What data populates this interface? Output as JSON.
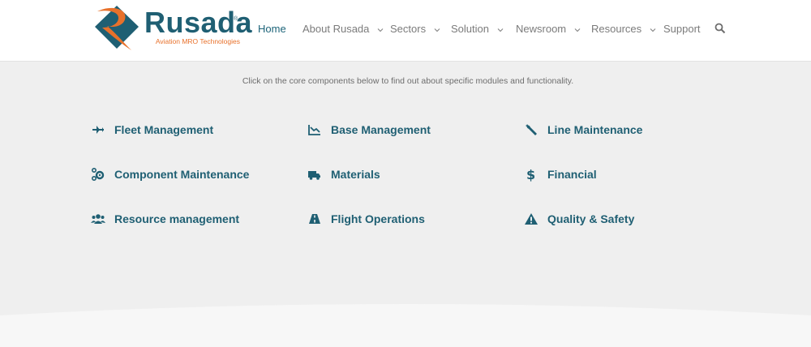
{
  "brand": {
    "name": "Rusada",
    "registered": "®",
    "tagline": "Aviation MRO Technologies"
  },
  "colors": {
    "primary": "#1f5f73",
    "accent": "#e8712b",
    "background": "#efefef"
  },
  "nav": {
    "items": [
      {
        "label": "Home",
        "active": true,
        "dropdown": false
      },
      {
        "label": "About Rusada",
        "active": false,
        "dropdown": true
      },
      {
        "label": "Sectors",
        "active": false,
        "dropdown": true
      },
      {
        "label": "Solution",
        "active": false,
        "dropdown": true
      },
      {
        "label": "Newsroom",
        "active": false,
        "dropdown": true
      },
      {
        "label": "Resources",
        "active": false,
        "dropdown": true
      },
      {
        "label": "Support",
        "active": false,
        "dropdown": false
      }
    ],
    "search_icon": "search-icon"
  },
  "main": {
    "intro": "Click on the core components below to find out about specific modules and functionality.",
    "modules": [
      {
        "label": "Fleet Management",
        "icon": "plane-icon"
      },
      {
        "label": "Base Management",
        "icon": "chart-icon"
      },
      {
        "label": "Line Maintenance",
        "icon": "wrench-icon"
      },
      {
        "label": "Component Maintenance",
        "icon": "cogs-icon"
      },
      {
        "label": "Materials",
        "icon": "truck-icon"
      },
      {
        "label": "Financial",
        "icon": "dollar-icon"
      },
      {
        "label": "Resource management",
        "icon": "users-icon"
      },
      {
        "label": "Flight Operations",
        "icon": "road-icon"
      },
      {
        "label": "Quality & Safety",
        "icon": "warning-icon"
      }
    ]
  }
}
